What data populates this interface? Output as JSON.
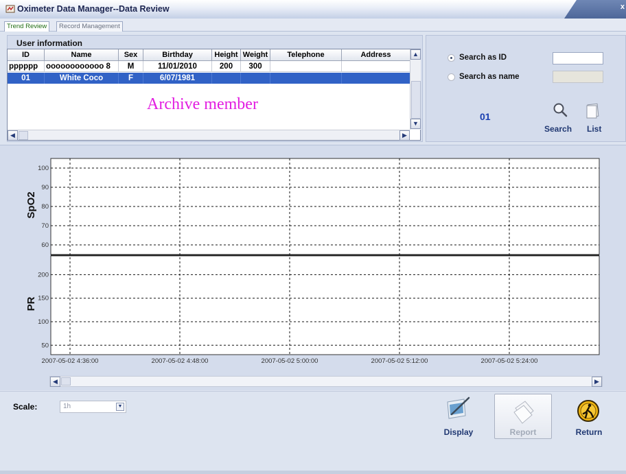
{
  "window": {
    "title": "Oximeter Data Manager--Data Review",
    "close_glyph": "x"
  },
  "tabs": [
    {
      "label": "Trend Review",
      "active": true
    },
    {
      "label": "Record Management",
      "active": false
    }
  ],
  "user_info": {
    "legend": "User information",
    "columns": [
      "ID",
      "Name",
      "Sex",
      "Birthday",
      "Height",
      "Weight",
      "Telephone",
      "Address"
    ],
    "rows": [
      {
        "id": "pppppp",
        "name": "oooooooooooo 8",
        "sex": "M",
        "birthday": "11/01/2010",
        "height": "200",
        "weight": "300",
        "telephone": "",
        "address": "",
        "selected": false
      },
      {
        "id": "01",
        "name": "White Coco",
        "sex": "F",
        "birthday": "6/07/1981",
        "height": "",
        "weight": "",
        "telephone": "",
        "address": "",
        "selected": true
      }
    ],
    "overlay_text": "Archive member"
  },
  "search": {
    "by_id_label": "Search as ID",
    "by_name_label": "Search as name",
    "selected_mode": "id",
    "id_value": "",
    "name_value": "",
    "current_id": "01",
    "search_label": "Search",
    "list_label": "List",
    "icons": [
      "magnifier-icon",
      "list-icon"
    ]
  },
  "chart_data": {
    "type": "line",
    "panels": [
      {
        "ylabel": "SpO2",
        "yticks": [
          60,
          70,
          80,
          90,
          100
        ],
        "ylim": [
          55,
          105
        ]
      },
      {
        "ylabel": "PR",
        "yticks": [
          50,
          100,
          150,
          200
        ],
        "ylim": [
          30,
          240
        ]
      }
    ],
    "x_ticks": [
      "2007-05-02  4:36:00",
      "2007-05-02  4:48:00",
      "2007-05-02  5:00:00",
      "2007-05-02  5:12:00",
      "2007-05-02  5:24:00"
    ],
    "series": [],
    "grid": true,
    "grid_style": "dashed"
  },
  "scale": {
    "label": "Scale:",
    "value": "1h"
  },
  "actions": {
    "display": "Display",
    "report": "Report",
    "return": "Return",
    "report_enabled": false
  },
  "colors": {
    "selected_row": "#3162c6",
    "overlay_text": "#e21ce1",
    "current_id": "#1a3fb0",
    "panel_bg": "#d4dcec"
  }
}
